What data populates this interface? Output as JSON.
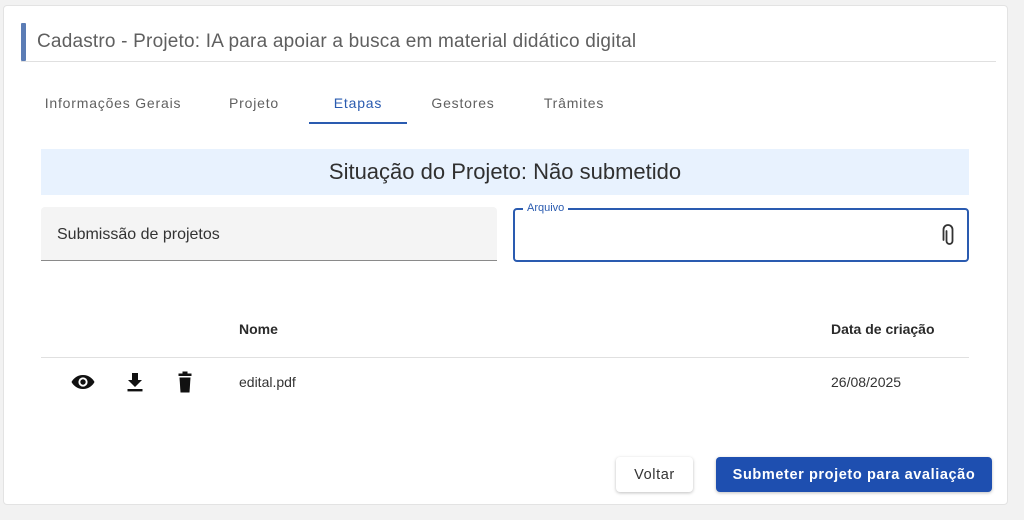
{
  "page": {
    "title": "Cadastro - Projeto: IA para apoiar a busca em material didático digital"
  },
  "tabs": [
    {
      "label": "Informações Gerais",
      "active": false
    },
    {
      "label": "Projeto",
      "active": false
    },
    {
      "label": "Etapas",
      "active": true
    },
    {
      "label": "Gestores",
      "active": false
    },
    {
      "label": "Trâmites",
      "active": false
    }
  ],
  "status": {
    "text": "Situação do Projeto: Não submetido"
  },
  "stage_select": {
    "value": "Submissão de projetos"
  },
  "file_input": {
    "label": "Arquivo",
    "icon": "paperclip-icon"
  },
  "table": {
    "headers": [
      "Nome",
      "Data de criação"
    ],
    "rows": [
      {
        "actions": [
          "eye-icon",
          "download-icon",
          "trash-icon"
        ],
        "name": "edital.pdf",
        "created": "26/08/2025"
      }
    ]
  },
  "buttons": {
    "back": "Voltar",
    "submit": "Submeter projeto para avaliação"
  },
  "colors": {
    "accent": "#2a5bb0",
    "primary_button": "#1e4fb0",
    "banner": "#e8f2fe",
    "title_accent": "#5b7cb5"
  }
}
